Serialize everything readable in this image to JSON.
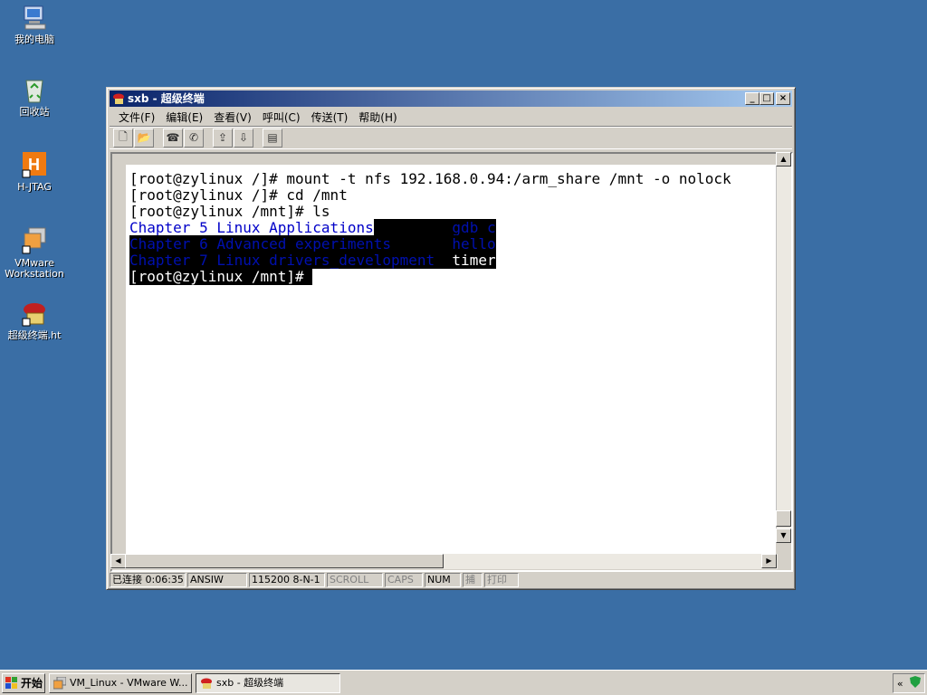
{
  "desktop": {
    "icons": [
      {
        "label": "我的电脑",
        "icon": "computer-icon"
      },
      {
        "label": "回收站",
        "icon": "recycle-bin-icon"
      },
      {
        "label": "H-JTAG",
        "icon": "hjtag-icon"
      },
      {
        "label": "VMware\nWorkstation",
        "icon": "vmware-icon"
      },
      {
        "label": "超级终端.ht",
        "icon": "hyperterminal-icon"
      }
    ]
  },
  "window": {
    "title": "sxb - 超级终端",
    "controls": {
      "minimize": "_",
      "maximize": "□",
      "close": "×"
    },
    "menu": [
      "文件(F)",
      "编辑(E)",
      "查看(V)",
      "呼叫(C)",
      "传送(T)",
      "帮助(H)"
    ],
    "toolbar": [
      {
        "name": "new-icon",
        "glyph": "🗋"
      },
      {
        "name": "open-icon",
        "glyph": "📂"
      },
      {
        "name": "call-icon",
        "glyph": "☎"
      },
      {
        "name": "disconnect-icon",
        "glyph": "✆"
      },
      {
        "name": "send-icon",
        "glyph": "⇪"
      },
      {
        "name": "receive-icon",
        "glyph": "⇩"
      },
      {
        "name": "properties-icon",
        "glyph": "▤"
      }
    ]
  },
  "terminal": {
    "line1": "[root@zylinux /]# mount -t nfs 192.168.0.94:/arm_share /mnt -o nolock",
    "line2": "[root@zylinux /]# cd /mnt",
    "line3": "[root@zylinux /mnt]# ls",
    "ls_col1": [
      "Chapter_5_Linux_Applications",
      "Chapter_6_Advanced_experiments",
      "Chapter_7_Linux_drivers_development"
    ],
    "ls_col2": [
      "gdb_c",
      "hello",
      "timer"
    ],
    "prompt": "[root@zylinux /mnt]# "
  },
  "status": {
    "connected": "已连接 0:06:35",
    "emulation": "ANSIW",
    "port": "115200 8-N-1",
    "scroll": "SCROLL",
    "caps": "CAPS",
    "num": "NUM",
    "capture": "捕",
    "print": "打印"
  },
  "taskbar": {
    "start": "开始",
    "tasks": [
      "VM_Linux - VMware W...",
      "sxb - 超级终端"
    ],
    "tray_chevron": "«"
  }
}
